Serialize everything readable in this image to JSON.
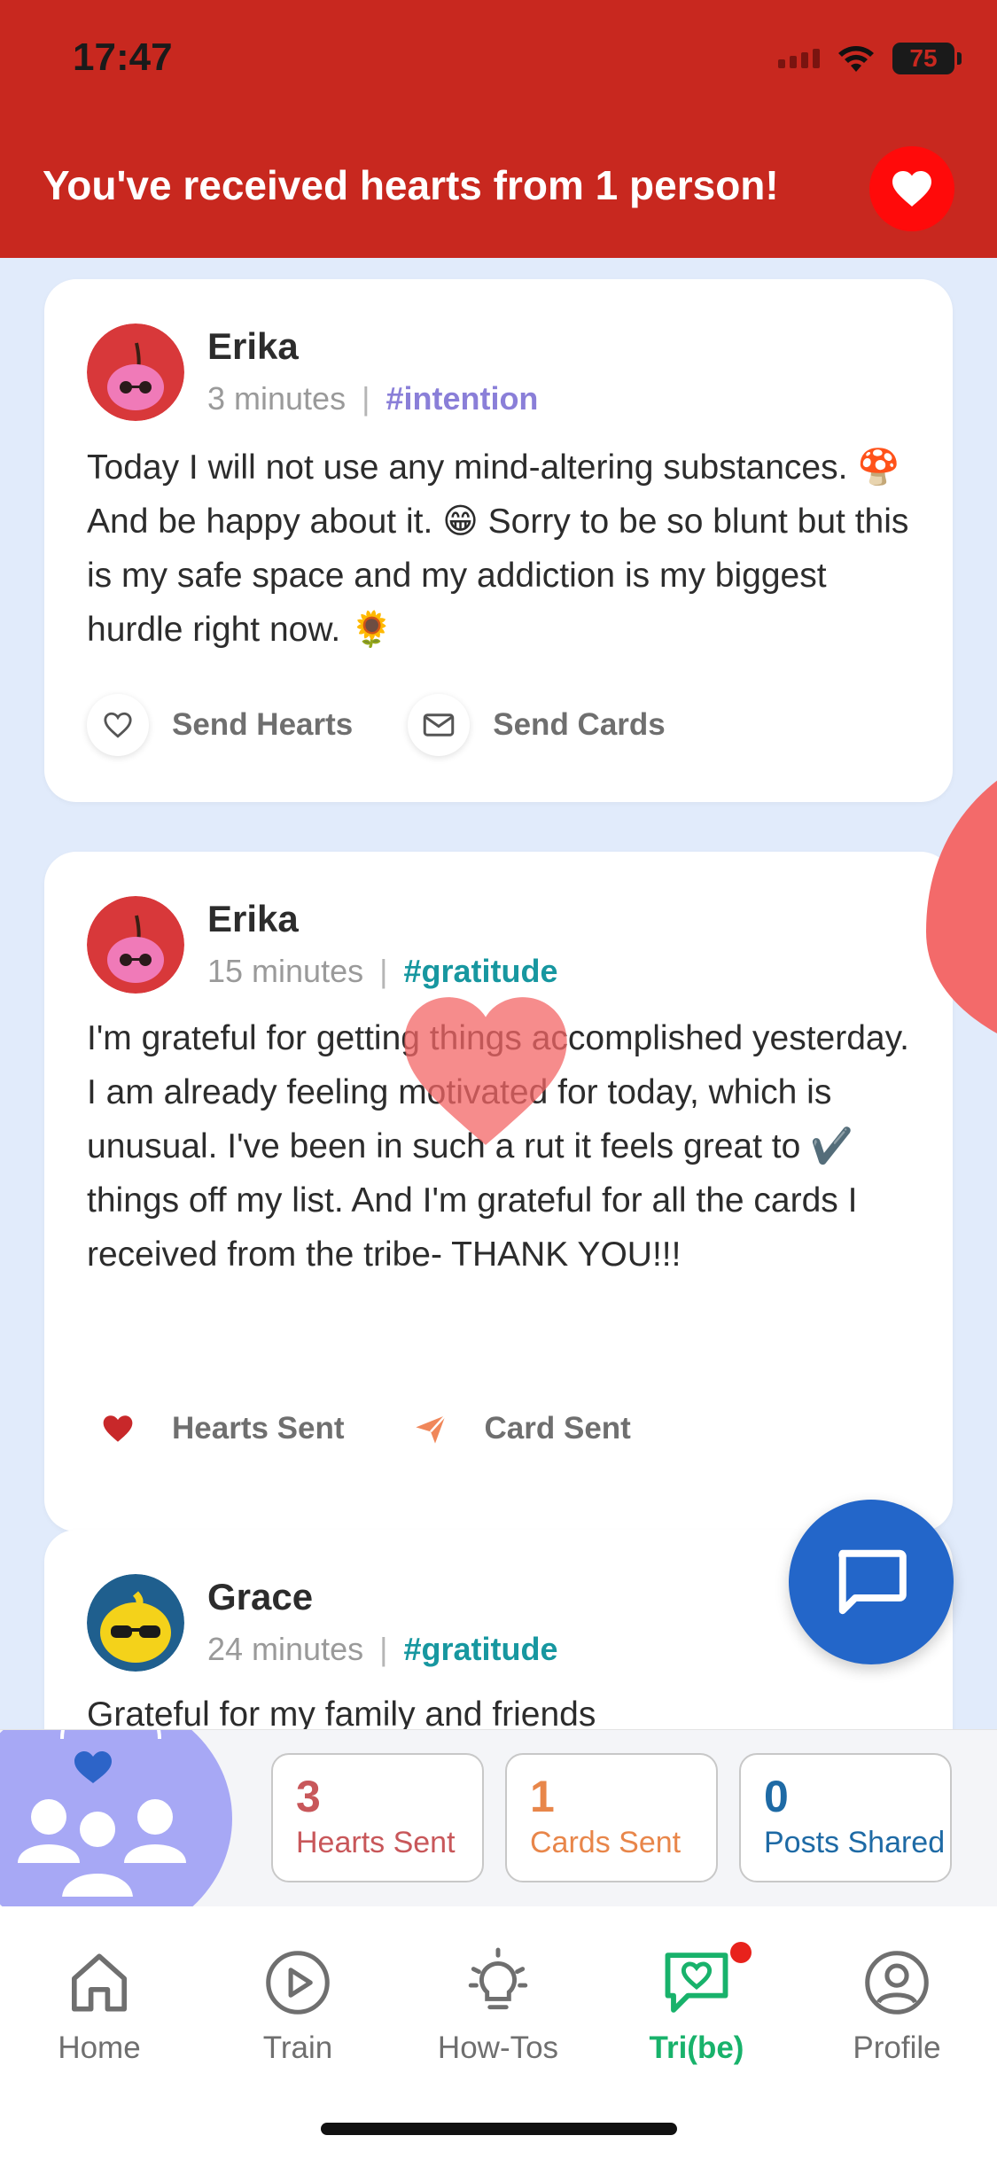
{
  "status_bar": {
    "time": "17:47",
    "battery": "75"
  },
  "banner": {
    "text": "You've received hearts from 1 person!"
  },
  "posts": [
    {
      "author": "Erika",
      "time": "3 minutes",
      "tag": "#intention",
      "body": "Today I will not use any mind-altering substances. 🍄 And be happy about it. 😁 Sorry to be so blunt but this is my safe space and my addiction is my biggest hurdle right now. 🌻",
      "actions": [
        "Send Hearts",
        "Send Cards"
      ]
    },
    {
      "author": "Erika",
      "time": "15 minutes",
      "tag": "#gratitude",
      "body": "I'm grateful for getting things accomplished yesterday. I am already feeling motivated for today, which is unusual. I've been in such a rut it feels great to ✔️ things off my list. And I'm grateful for all the cards I received from the tribe- THANK YOU!!!",
      "actions": [
        "Hearts Sent",
        "Card Sent"
      ]
    },
    {
      "author": "Grace",
      "time": "24 minutes",
      "tag": "#gratitude",
      "body": "Grateful for my family and friends"
    }
  ],
  "stats": [
    {
      "value": "3",
      "label": "Hearts Sent",
      "color": "#c8575a"
    },
    {
      "value": "1",
      "label": "Cards Sent",
      "color": "#e8864a"
    },
    {
      "value": "0",
      "label": "Posts Shared",
      "color": "#1e6aa5"
    }
  ],
  "tabs": [
    {
      "label": "Home",
      "icon": "home-icon"
    },
    {
      "label": "Train",
      "icon": "play-icon"
    },
    {
      "label": "How-Tos",
      "icon": "lightbulb-icon"
    },
    {
      "label": "Tri(be)",
      "icon": "chat-heart-icon",
      "active": true
    },
    {
      "label": "Profile",
      "icon": "profile-icon"
    }
  ],
  "colors": {
    "brand_red": "#c8281f",
    "accent_green": "#18b26b",
    "fab_blue": "#2366c9"
  }
}
